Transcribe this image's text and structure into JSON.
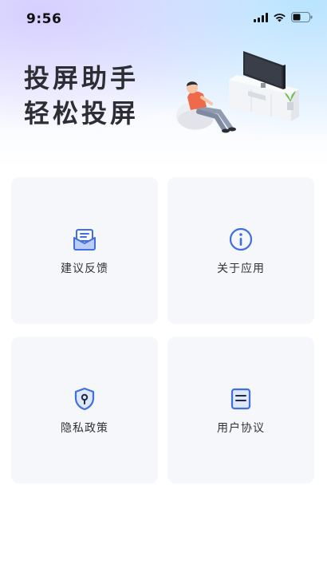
{
  "status_bar": {
    "time": "9:56"
  },
  "hero": {
    "title_line1": "投屏助手",
    "title_line2": "轻松投屏"
  },
  "menu": [
    {
      "label": "建议反馈",
      "icon": "feedback-mail-icon"
    },
    {
      "label": "关于应用",
      "icon": "info-icon"
    },
    {
      "label": "隐私政策",
      "icon": "privacy-shield-icon"
    },
    {
      "label": "用户协议",
      "icon": "agreement-document-icon"
    }
  ],
  "colors": {
    "accent": "#3f6fe0",
    "card_bg": "#f6f7fb",
    "text": "#333333"
  }
}
